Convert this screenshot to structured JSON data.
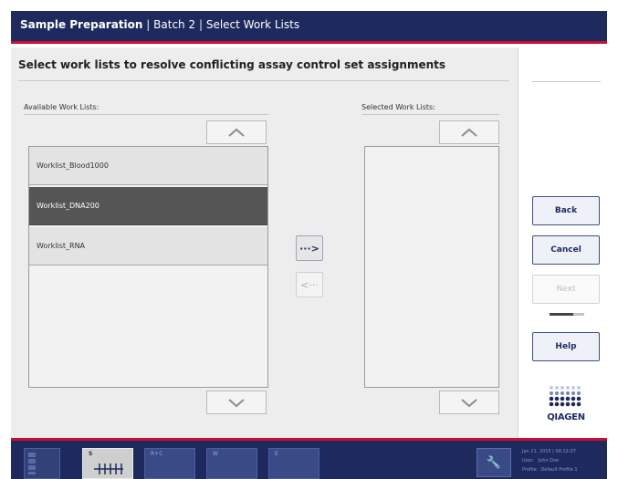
{
  "header": {
    "title_bold": "Sample Preparation",
    "separator": "|",
    "batch": "Batch 2",
    "step": "Select Work Lists"
  },
  "main": {
    "heading": "Select work lists to resolve conflicting assay control set assignments",
    "available_label": "Available Work Lists:",
    "selected_label": "Selected Work Lists:",
    "available_items": [
      {
        "label": "Worklist_Blood1000",
        "selected": false
      },
      {
        "label": "Worklist_DNA200",
        "selected": true
      },
      {
        "label": "Worklist_RNA",
        "selected": false
      }
    ],
    "selected_items": [],
    "move_right_label": "···>",
    "move_left_label": "<···"
  },
  "side": {
    "back": "Back",
    "cancel": "Cancel",
    "next": "Next",
    "help": "Help",
    "logo_text": "QIAGEN"
  },
  "bottom": {
    "tabs": [
      "S",
      "R+C",
      "W",
      "E"
    ],
    "active_tab": "S",
    "date": "Jan 21, 2015 | 08:12:07",
    "user_label": "User:",
    "user": "John Doe",
    "profile_label": "Profile:",
    "profile": "Default Profile 1"
  },
  "colors": {
    "navy": "#1e2a5e",
    "accent_red": "#c8102e",
    "selected_row": "#555555",
    "panel_bg": "#ededed"
  }
}
